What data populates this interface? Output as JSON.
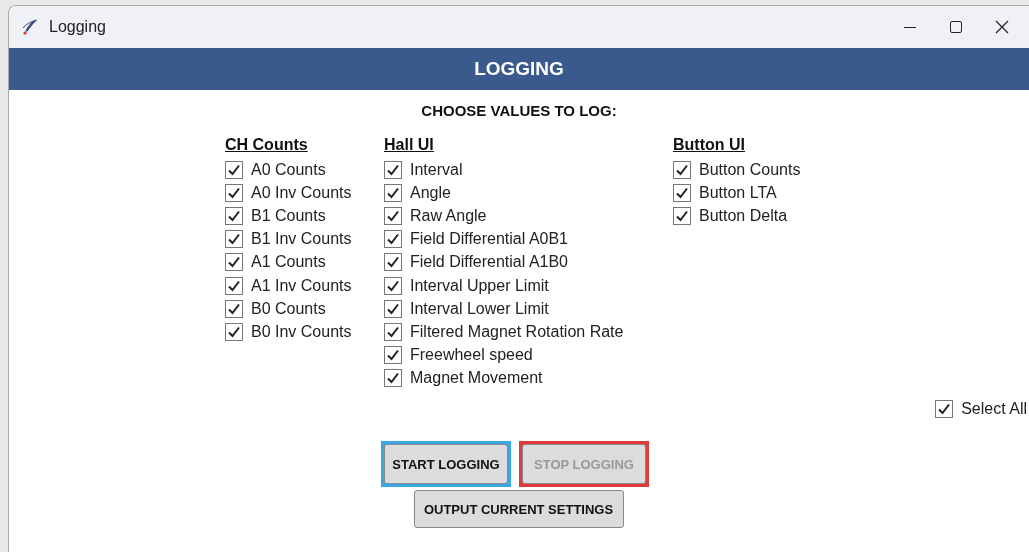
{
  "window": {
    "title": "Logging"
  },
  "header": "LOGGING",
  "prompt": "CHOOSE VALUES TO LOG:",
  "groups": [
    {
      "title": "CH Counts",
      "items": [
        {
          "label": "A0 Counts",
          "checked": true
        },
        {
          "label": "A0 Inv Counts",
          "checked": true
        },
        {
          "label": "B1 Counts",
          "checked": true
        },
        {
          "label": "B1 Inv Counts",
          "checked": true
        },
        {
          "label": "A1 Counts",
          "checked": true
        },
        {
          "label": "A1 Inv Counts",
          "checked": true
        },
        {
          "label": "B0 Counts",
          "checked": true
        },
        {
          "label": "B0 Inv Counts",
          "checked": true
        }
      ]
    },
    {
      "title": "Hall UI",
      "items": [
        {
          "label": "Interval",
          "checked": true
        },
        {
          "label": "Angle",
          "checked": true
        },
        {
          "label": "Raw Angle",
          "checked": true
        },
        {
          "label": "Field Differential A0B1",
          "checked": true
        },
        {
          "label": "Field Differential A1B0",
          "checked": true
        },
        {
          "label": "Interval Upper Limit",
          "checked": true
        },
        {
          "label": "Interval Lower Limit",
          "checked": true
        },
        {
          "label": "Filtered Magnet Rotation Rate",
          "checked": true
        },
        {
          "label": "Freewheel speed",
          "checked": true
        },
        {
          "label": "Magnet Movement",
          "checked": true
        }
      ]
    },
    {
      "title": "Button UI",
      "items": [
        {
          "label": "Button Counts",
          "checked": true
        },
        {
          "label": "Button LTA",
          "checked": true
        },
        {
          "label": "Button Delta",
          "checked": true
        }
      ]
    }
  ],
  "select_all": {
    "label": "Select All",
    "checked": true
  },
  "buttons": [
    {
      "label": "START LOGGING",
      "disabled": false,
      "color": "#3aa8e0"
    },
    {
      "label": "STOP LOGGING",
      "disabled": true,
      "color": "#e03a3a"
    },
    {
      "label": "OUTPUT CURRENT SETTINGS",
      "disabled": false
    }
  ]
}
